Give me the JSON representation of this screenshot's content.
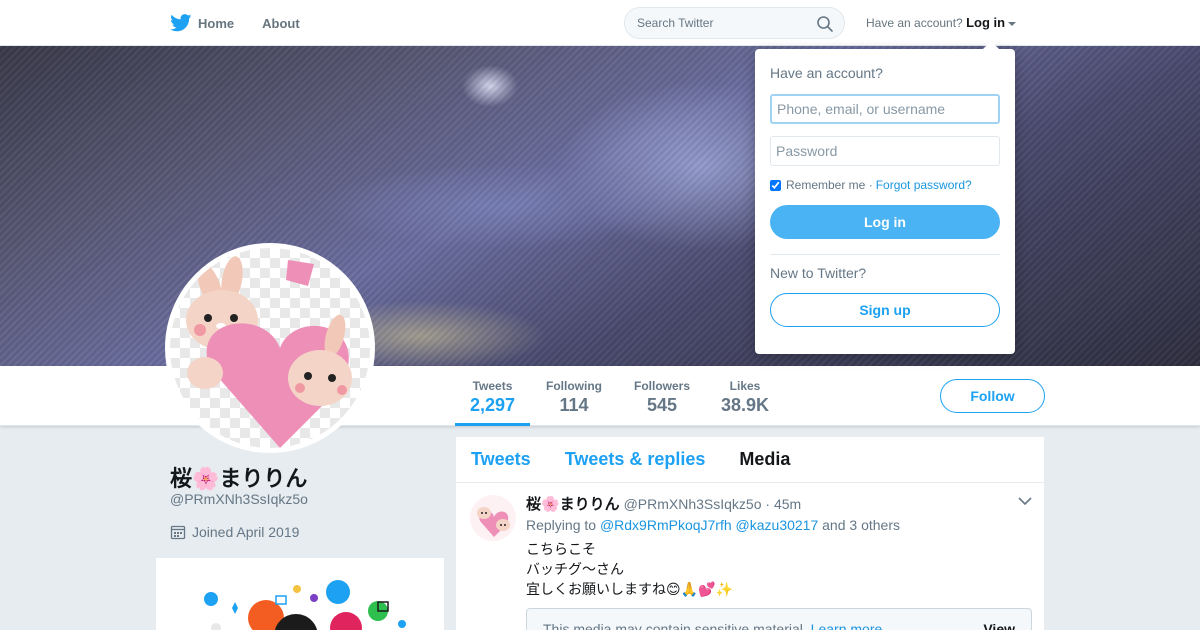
{
  "nav": {
    "home_label": "Home",
    "about_label": "About",
    "search_placeholder": "Search Twitter",
    "account_prompt": "Have an account?",
    "login_label": "Log in"
  },
  "profile": {
    "name": "桜🌸まりりん",
    "handle": "@PRmXNh3SsIqkz5o",
    "joined": "Joined April 2019"
  },
  "stats": [
    {
      "label": "Tweets",
      "value": "2,297"
    },
    {
      "label": "Following",
      "value": "114"
    },
    {
      "label": "Followers",
      "value": "545"
    },
    {
      "label": "Likes",
      "value": "38.9K"
    }
  ],
  "follow_label": "Follow",
  "tabs": [
    {
      "label": "Tweets"
    },
    {
      "label": "Tweets & replies"
    },
    {
      "label": "Media"
    }
  ],
  "tweet": {
    "author_name": "桜🌸まりりん",
    "author_handle": "@PRmXNh3SsIqkz5o",
    "time": "· 45m",
    "replying_prefix": "Replying to",
    "reply_user_1": "@Rdx9RmPkoqJ7rfh",
    "reply_user_2": "@kazu30217",
    "reply_suffix": "and 3 others",
    "line_1": "こちらこそ",
    "line_2": "バッチグ〜さん",
    "line_3": "宜しくお願いしますね😊🙏💕✨",
    "sensitive_text": "This media may contain sensitive material.",
    "learn_more": "Learn more",
    "view_label": "View"
  },
  "login_dropdown": {
    "title": "Have an account?",
    "username_placeholder": "Phone, email, or username",
    "password_placeholder": "Password",
    "remember_label": "Remember me ·",
    "forgot_label": "Forgot password?",
    "login_button": "Log in",
    "new_prompt": "New to Twitter?",
    "signup_button": "Sign up",
    "remember_checked": true
  },
  "colors": {
    "accent": "#1da1f2",
    "login_button": "#4ab3f4",
    "background": "#e6ecf0"
  }
}
